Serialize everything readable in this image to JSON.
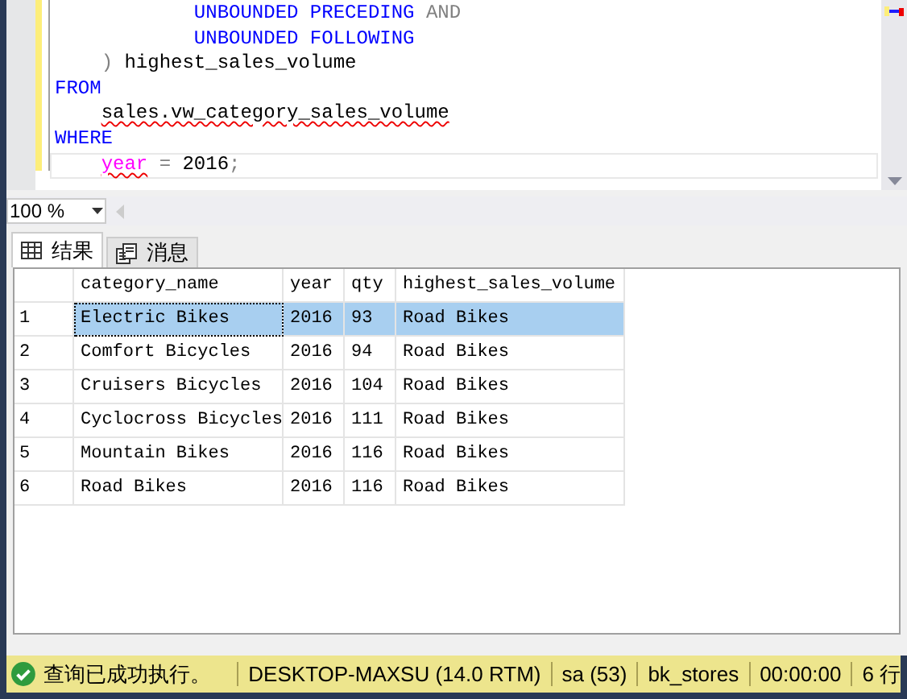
{
  "editor": {
    "lines": [
      {
        "current": false,
        "tokens": [
          {
            "kind": "keyword",
            "text": "            UNBOUNDED PRECEDING"
          },
          {
            "kind": "operator",
            "text": " AND"
          }
        ]
      },
      {
        "current": false,
        "tokens": [
          {
            "kind": "keyword",
            "text": "            UNBOUNDED FOLLOWING"
          }
        ]
      },
      {
        "current": false,
        "tokens": [
          {
            "kind": "operator",
            "text": "    )"
          },
          {
            "kind": "plain",
            "text": " highest_sales_volume"
          }
        ]
      },
      {
        "current": false,
        "tokens": [
          {
            "kind": "keyword",
            "text": "FROM"
          }
        ]
      },
      {
        "current": false,
        "tokens": [
          {
            "kind": "error",
            "text": "    sales.vw_category_sales_volume"
          }
        ]
      },
      {
        "current": false,
        "tokens": [
          {
            "kind": "keyword",
            "text": "WHERE"
          }
        ]
      },
      {
        "current": true,
        "tokens": [
          {
            "kind": "function-error",
            "text": "    year"
          },
          {
            "kind": "operator",
            "text": " ="
          },
          {
            "kind": "plain",
            "text": " 2016"
          },
          {
            "kind": "operator",
            "text": ";"
          }
        ]
      }
    ]
  },
  "zoom": {
    "value": "100 %"
  },
  "tabs": [
    {
      "label": "结果",
      "selected": true
    },
    {
      "label": "消息",
      "selected": false
    }
  ],
  "grid": {
    "columns": [
      "category_name",
      "year",
      "qty",
      "highest_sales_volume"
    ],
    "rows": [
      {
        "number": "1",
        "selected": true,
        "cells": [
          "Electric Bikes",
          "2016",
          "93",
          "Road Bikes"
        ]
      },
      {
        "number": "2",
        "selected": false,
        "cells": [
          "Comfort Bicycles",
          "2016",
          "94",
          "Road Bikes"
        ]
      },
      {
        "number": "3",
        "selected": false,
        "cells": [
          "Cruisers Bicycles",
          "2016",
          "104",
          "Road Bikes"
        ]
      },
      {
        "number": "4",
        "selected": false,
        "cells": [
          "Cyclocross Bicycles",
          "2016",
          "111",
          "Road Bikes"
        ]
      },
      {
        "number": "5",
        "selected": false,
        "cells": [
          "Mountain Bikes",
          "2016",
          "116",
          "Road Bikes"
        ]
      },
      {
        "number": "6",
        "selected": false,
        "cells": [
          "Road Bikes",
          "2016",
          "116",
          "Road Bikes"
        ]
      }
    ]
  },
  "status_bar": {
    "message": "查询已成功执行。",
    "server": "DESKTOP-MAXSU (14.0 RTM)",
    "user": "sa (53)",
    "database": "bk_stores",
    "elapsed": "00:00:00",
    "rows": "6 行"
  }
}
